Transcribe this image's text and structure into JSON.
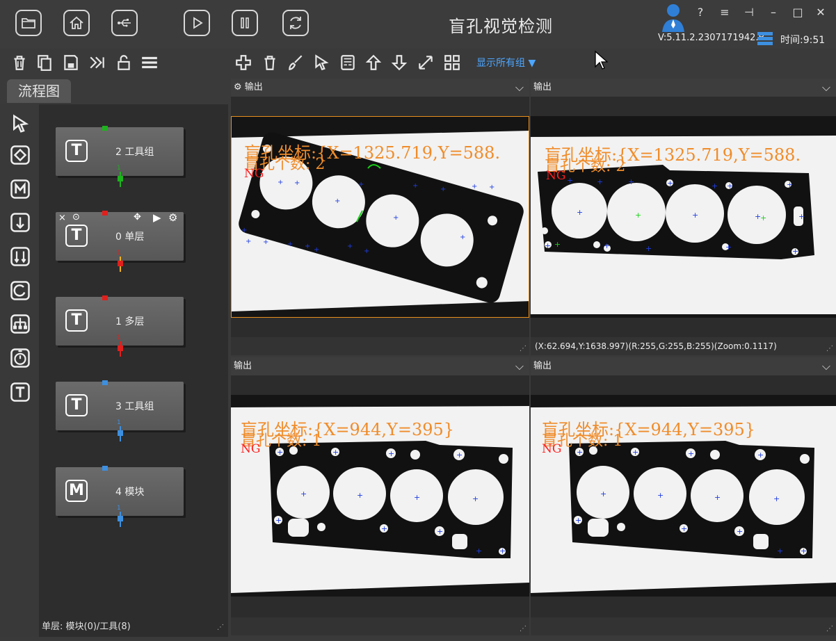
{
  "app": {
    "title": "盲孔视觉检测",
    "version": "V:5.11.2.2307171942.B",
    "time": "时间:9:51",
    "window_controls": [
      "?",
      "≡",
      "⊣",
      "–",
      "□",
      "✕"
    ]
  },
  "top_buttons": [
    "folder-icon",
    "home-icon",
    "usb-icon",
    "play-icon",
    "pause-icon",
    "refresh-icon"
  ],
  "left_toolbar_icons": [
    "trash-icon",
    "copy-icon",
    "save-icon",
    "skip-icon",
    "unlock-icon",
    "menu-icon"
  ],
  "right_toolbar_icons": [
    "add-icon",
    "trash-icon",
    "brush-icon",
    "pointer-icon",
    "calc-icon",
    "arrow-up-icon",
    "arrow-down-icon",
    "expand-icon",
    "grid-icon"
  ],
  "show_groups": "显示所有组",
  "flow": {
    "tab_label": "流程图",
    "side_tools": [
      "pointer-icon",
      "diamond-icon",
      "m-icon",
      "down-arrow-icon",
      "split-icon",
      "loop-icon",
      "tree-icon",
      "timer-icon",
      "t-icon"
    ],
    "nodes": [
      {
        "label": "2 工具组",
        "icon": "T",
        "port_color": "#1db31d",
        "link_color": "#1db31d",
        "link_num": "1"
      },
      {
        "label": "0 单层",
        "icon": "T",
        "port_color": "#e0201d",
        "link_color": "#f0b020",
        "link_num": "1"
      },
      {
        "label": "1 多层",
        "icon": "T",
        "port_color": "#e0201d",
        "link_color": "#e0201d",
        "link_num": "1"
      },
      {
        "label": "3 工具组",
        "icon": "T",
        "port_color": "#3d8fe0",
        "link_color": "#3d8fe0",
        "link_num": "1"
      },
      {
        "label": "4 模块",
        "icon": "M",
        "port_color": "#3d8fe0",
        "link_color": "#3d8fe0",
        "link_num": "1"
      }
    ],
    "status": "单层: 模块(0)/工具(8)"
  },
  "panes": [
    {
      "title": "输出",
      "has_gear": true,
      "coord": "盲孔坐标:{X=1325.719,Y=588.",
      "count": "盲孔个数: 2",
      "ng": "NG",
      "footer": ""
    },
    {
      "title": "输出",
      "has_gear": false,
      "coord": "盲孔坐标:{X=1325.719,Y=588.",
      "count": "盲孔个数: 2",
      "ng": "NG",
      "footer": "(X:62.694,Y:1638.997)(R:255,G:255,B:255)(Zoom:0.1117)"
    },
    {
      "title": "输出",
      "has_gear": false,
      "coord": "盲孔坐标:{X=944,Y=395}",
      "count": "盲孔个数: 1",
      "ng": "NG",
      "footer": ""
    },
    {
      "title": "输出",
      "has_gear": false,
      "coord": "盲孔坐标:{X=944,Y=395}",
      "count": "盲孔个数: 1",
      "ng": "NG",
      "footer": ""
    }
  ],
  "colors": {
    "accent": "#4da6ff",
    "selected_border": "#e8901e",
    "overlay_text": "#f08c2a",
    "ng": "#ff2020"
  }
}
